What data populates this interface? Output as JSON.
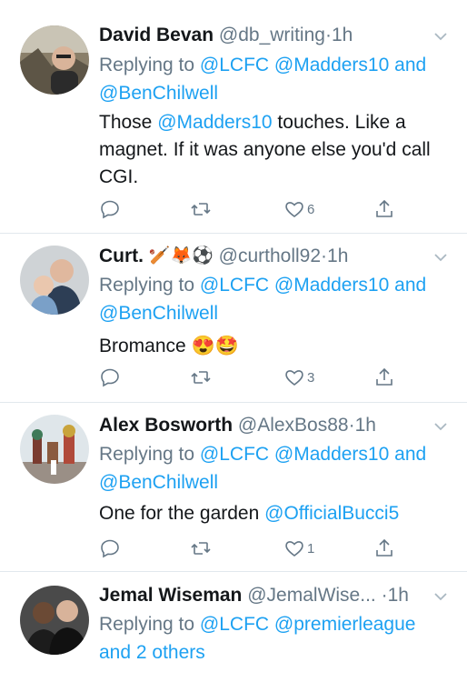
{
  "tweets": [
    {
      "name": "David Bevan",
      "handle": "@db_writing",
      "time": "1h",
      "reply_prefix": "Replying to",
      "reply_to_1": "@LCFC",
      "reply_to_2": "@Madders10",
      "reply_and": "and",
      "reply_to_3": "@BenChilwell",
      "body_1": "Those ",
      "body_mention": "@Madders10",
      "body_2": " touches. Like a magnet. If it was anyone else you'd call CGI.",
      "likes": "6"
    },
    {
      "name": "Curt.",
      "name_emoji": "🏏🦊⚽",
      "handle": "@curtholl92",
      "time": "1h",
      "reply_prefix": "Replying to",
      "reply_to_1": "@LCFC",
      "reply_to_2": "@Madders10",
      "reply_and": "and",
      "reply_to_3": "@BenChilwell",
      "body_1": "Bromance",
      "body_emoji": "😍🤩",
      "likes": "3"
    },
    {
      "name": "Alex Bosworth",
      "handle": "@AlexBos88",
      "time": "1h",
      "reply_prefix": "Replying to",
      "reply_to_1": "@LCFC",
      "reply_to_2": "@Madders10",
      "reply_and": "and",
      "reply_to_3": "@BenChilwell",
      "body_1": "One for the garden ",
      "body_mention": "@OfficialBucci5",
      "likes": "1"
    },
    {
      "name": "Jemal Wiseman",
      "handle": "@JemalWise...",
      "time": "1h",
      "reply_prefix": "Replying to",
      "reply_to_1": "@LCFC",
      "reply_to_2": "@premierleague",
      "reply_others": "and 2 others"
    }
  ],
  "colors": {
    "link": "#1da1f2",
    "muted": "#657786",
    "divider": "#e1e8ed"
  },
  "icons": [
    "reply-icon",
    "retweet-icon",
    "like-icon",
    "share-icon",
    "chevron-down-icon"
  ]
}
